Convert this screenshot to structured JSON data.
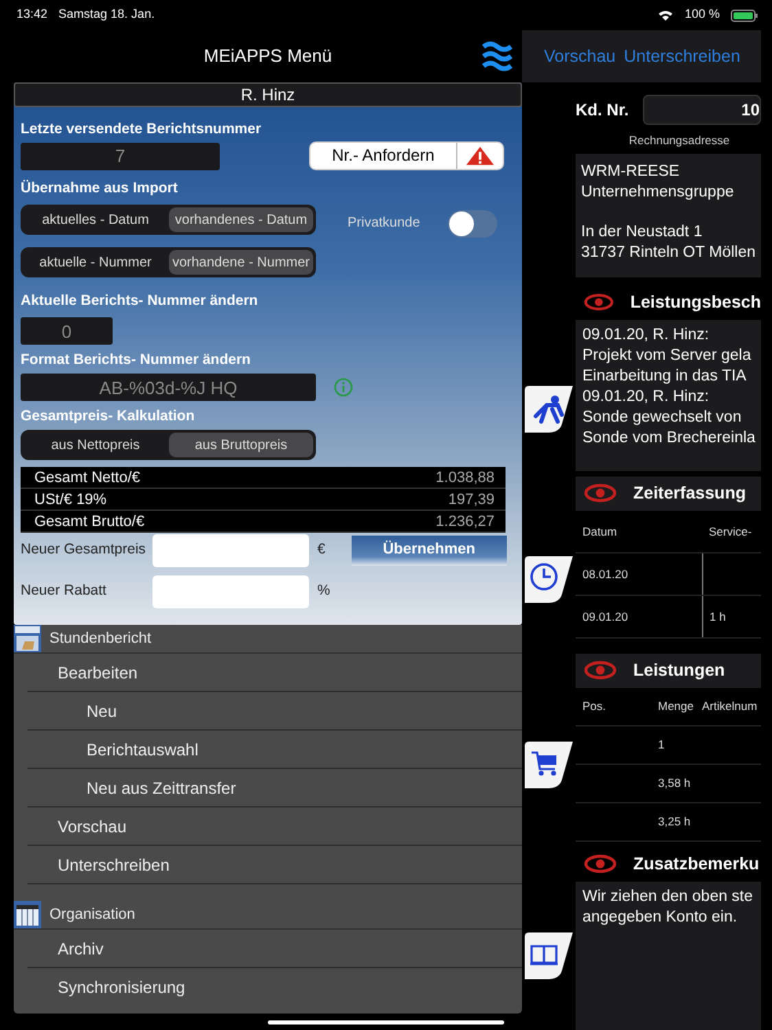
{
  "status_bar": {
    "time": "13:42",
    "date": "Samstag 18. Jan.",
    "battery": "100 %"
  },
  "menu_header": {
    "title": "MEiAPPS Menü"
  },
  "report_settings": {
    "user": "R. Hinz",
    "last_number_label": "Letzte versendete Berichtsnummer",
    "last_number": "7",
    "request_button": "Nr.- Anfordern",
    "import_label": "Übernahme aus Import",
    "import_options": [
      [
        {
          "label": "aktuelles - Datum",
          "selected": false
        },
        {
          "label": "vorhandenes - Datum",
          "selected": true
        }
      ],
      [
        {
          "label": "aktuelle - Nummer",
          "selected": false
        },
        {
          "label": "vorhandene - Nummer",
          "selected": true
        }
      ]
    ],
    "private_customer": {
      "label": "Privatkunde",
      "on": false
    },
    "change_number_label": "Aktuelle Berichts- Nummer ändern",
    "change_number": "0",
    "format_label": "Format Berichts- Nummer ändern",
    "format": "AB-%03d-%J HQ",
    "calculation_label": "Gesamtpreis- Kalkulation",
    "calculation_options": [
      {
        "label": "aus Nettopreis",
        "selected": false
      },
      {
        "label": "aus Bruttopreis",
        "selected": true
      }
    ],
    "totals": [
      {
        "label": "Gesamt Netto/€",
        "value": "1.038,88"
      },
      {
        "label": "USt/€ 19%",
        "value": "197,39"
      },
      {
        "label": "Gesamt Brutto/€",
        "value": "1.236,27"
      }
    ],
    "new_total": {
      "label": "Neuer Gesamtpreis",
      "unit": "€"
    },
    "apply_button": "Übernehmen",
    "new_discount": {
      "label": "Neuer Rabatt",
      "unit": "%"
    }
  },
  "menu": [
    {
      "title": "Stundenbericht",
      "items": [
        {
          "label": "Bearbeiten",
          "children": [
            {
              "label": "Neu"
            },
            {
              "label": "Berichtauswahl"
            },
            {
              "label": "Neu aus Zeittransfer"
            }
          ]
        },
        {
          "label": "Vorschau"
        },
        {
          "label": "Unterschreiben"
        }
      ]
    },
    {
      "title": "Organisation",
      "items": [
        {
          "label": "Archiv"
        },
        {
          "label": "Synchronisierung"
        }
      ]
    }
  ],
  "report_detail": {
    "actions": [
      "Vorschau",
      "Unterschreiben"
    ],
    "customer_label": "Kd. Nr.",
    "customer_number": "10",
    "address_label": "Rechnungsadresse",
    "address": [
      [
        "WRM-REESE",
        "Unternehmensgruppe"
      ],
      [
        "In der Neustadt 1",
        "31737 Rinteln OT Möllen"
      ]
    ],
    "sections": [
      {
        "kind": "text",
        "title": "Leistungsbesch",
        "lines": [
          "09.01.20, R. Hinz:",
          "Projekt vom Server gela",
          "Einarbeitung in das TIA",
          "09.01.20, R. Hinz:",
          "Sonde gewechselt von",
          "Sonde vom Brechereinla"
        ]
      },
      {
        "kind": "table",
        "title": "Zeiterfassung",
        "columns": [
          "Datum",
          "Service-"
        ],
        "rows": [
          [
            "08.01.20",
            null
          ],
          [
            "09.01.20",
            "1 h"
          ]
        ]
      },
      {
        "kind": "table",
        "title": "Leistungen",
        "columns": [
          "Pos.",
          "Menge",
          "Artikelnum"
        ],
        "rows": [
          [
            null,
            "1",
            null
          ],
          [
            null,
            "3,58 h",
            null
          ],
          [
            null,
            "3,25 h",
            null
          ]
        ]
      },
      {
        "kind": "text",
        "title": "Zusatzbemerku",
        "lines": [
          "Wir ziehen den oben ste",
          "angegeben Konto ein."
        ]
      }
    ]
  }
}
